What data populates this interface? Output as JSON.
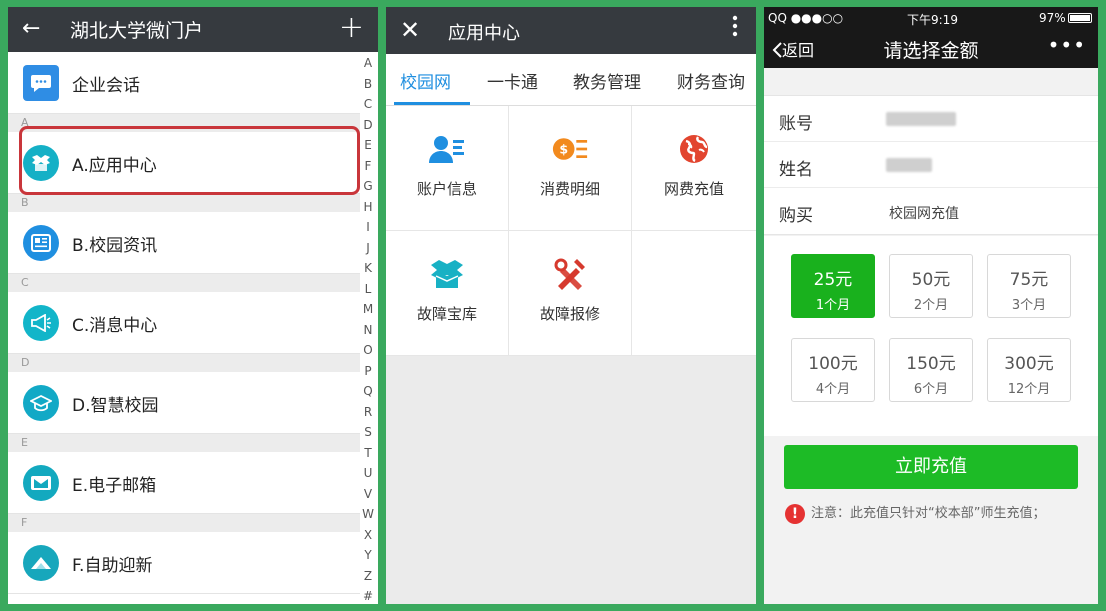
{
  "colors": {
    "background": "#3aa95e",
    "header": "#363a3f",
    "highlight": "#c9363b",
    "tab_active": "#1f8fe0",
    "primary_green": "#1dbb26"
  },
  "panel1": {
    "header": {
      "back_icon": "←",
      "title": "湖北大学微门户",
      "add_icon": "+"
    },
    "items": [
      {
        "section": "",
        "label": "企业会话",
        "icon": "chat-icon",
        "color": "#2f8de4"
      },
      {
        "section": "A",
        "label": "A.应用中心",
        "icon": "box-icon",
        "color": "#15b0c6"
      },
      {
        "section": "B",
        "label": "B.校园资讯",
        "icon": "news-icon",
        "color": "#1f8fe0"
      },
      {
        "section": "C",
        "label": "C.消息中心",
        "icon": "megaphone-icon",
        "color": "#12b5c9"
      },
      {
        "section": "D",
        "label": "D.智慧校园",
        "icon": "graduation-cap-icon",
        "color": "#12a9c6"
      },
      {
        "section": "E",
        "label": "E.电子邮箱",
        "icon": "mail-icon",
        "color": "#13a9bf"
      },
      {
        "section": "F",
        "label": "F.自助迎新",
        "icon": "mountain-icon",
        "color": "#17a7bc"
      }
    ],
    "index_letters": [
      "A",
      "B",
      "C",
      "D",
      "E",
      "F",
      "G",
      "H",
      "I",
      "J",
      "K",
      "L",
      "M",
      "N",
      "O",
      "P",
      "Q",
      "R",
      "S",
      "T",
      "U",
      "V",
      "W",
      "X",
      "Y",
      "Z",
      "#"
    ]
  },
  "panel2": {
    "header": {
      "close_icon": "✕",
      "title": "应用中心",
      "more_icon": "⋮"
    },
    "tabs": [
      "校园网",
      "一卡通",
      "教务管理",
      "财务查询"
    ],
    "apps": [
      {
        "label": "账户信息",
        "icon": "account-card-icon"
      },
      {
        "label": "消费明细",
        "icon": "coin-list-icon"
      },
      {
        "label": "网费充值",
        "icon": "globe-icon"
      },
      {
        "label": "故障宝库",
        "icon": "box-icon"
      },
      {
        "label": "故障报修",
        "icon": "tools-icon"
      }
    ]
  },
  "panel3": {
    "status": {
      "carrier": "QQ ●●●○○",
      "time": "下午9:19",
      "battery": "97%"
    },
    "nav": {
      "back": "返回",
      "title": "请选择金额",
      "more": "•••"
    },
    "info": [
      {
        "key": "账号",
        "value": ""
      },
      {
        "key": "姓名",
        "value": ""
      },
      {
        "key": "购买",
        "value": "校园网充值"
      }
    ],
    "amounts": [
      {
        "amount": "25元",
        "months": "1个月",
        "selected": true
      },
      {
        "amount": "50元",
        "months": "2个月",
        "selected": false
      },
      {
        "amount": "75元",
        "months": "3个月",
        "selected": false
      },
      {
        "amount": "100元",
        "months": "4个月",
        "selected": false
      },
      {
        "amount": "150元",
        "months": "6个月",
        "selected": false
      },
      {
        "amount": "300元",
        "months": "12个月",
        "selected": false
      }
    ],
    "submit": "立即充值",
    "note": "注意：此充值只针对“校本部”师生充值；"
  }
}
